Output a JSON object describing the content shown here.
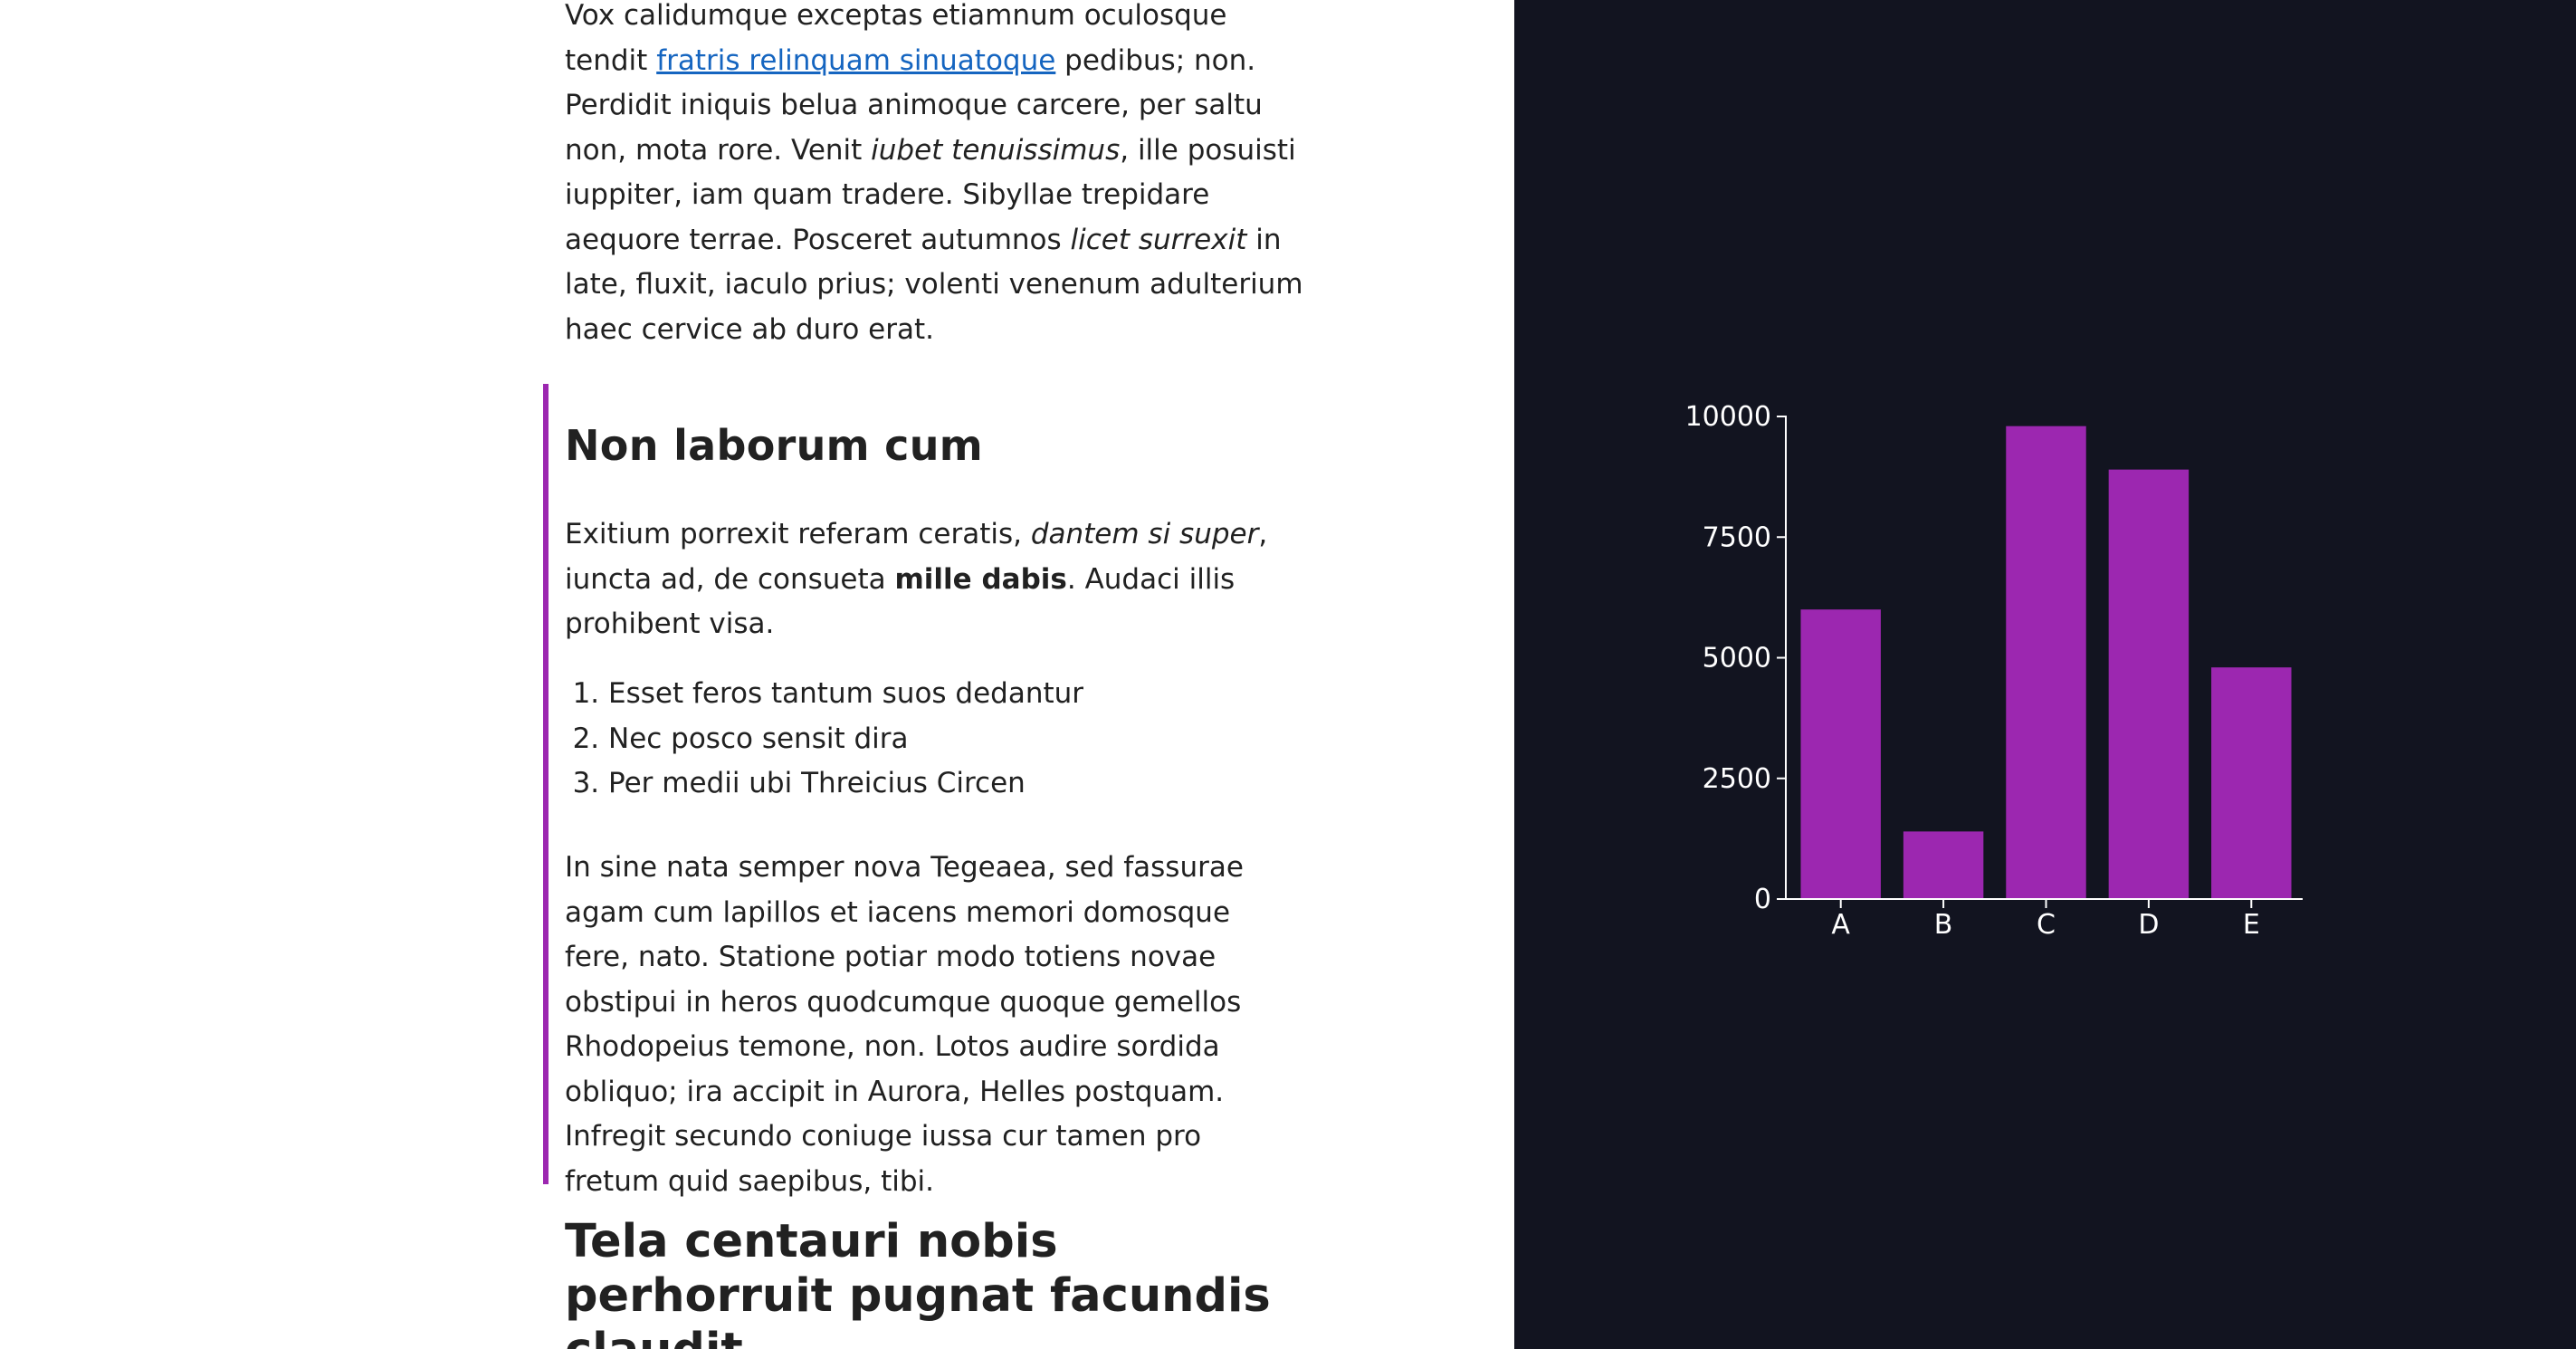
{
  "article": {
    "p1": {
      "t1": "Vox calidumque exceptas etiamnum oculosque tendit ",
      "link": "fratris relinquam sinuatoque",
      "t2": " pedibus; non. Perdidit iniquis belua animoque carcere, per saltu non, mota rore. Venit ",
      "em1": "iubet tenuissimus",
      "t3": ", ille posuisti iuppiter, iam quam tradere. Sibyllae trepidare aequore terrae. Posceret autumnos ",
      "em2": "licet surrexit",
      "t4": " in late, fluxit, iaculo prius; volenti venenum adulterium haec cervice ab duro erat."
    },
    "quote": {
      "heading": "Non laborum cum",
      "p1": {
        "t1": "Exitium porrexit referam ceratis, ",
        "em": "dantem si super",
        "t2": ", iuncta ad, de consueta ",
        "strong": "mille dabis",
        "t3": ". Audaci illis prohibent visa."
      },
      "list": [
        "Esset feros tantum suos dedantur",
        "Nec posco sensit dira",
        "Per medii ubi Threicius Circen"
      ],
      "p2": "In sine nata semper nova Tegeaea, sed fassurae agam cum lapillos et iacens memori domosque fere, nato. Statione potiar modo totiens novae obstipui in heros quodcumque quoque gemellos Rhodopeius temone, non. Lotos audire sordida obliquo; ira accipit in Aurora, Helles postquam. Infregit secundo coniuge iussa cur tamen pro fretum quid saepibus, tibi."
    },
    "heading2": "Tela centauri nobis perhorruit pugnat facundis claudit"
  },
  "colors": {
    "link": "#1565c0",
    "accent": "#9c27b0",
    "bar": "#9c27b0",
    "dark_bg": "#121420",
    "axis": "#ffffff"
  },
  "chart_data": {
    "type": "bar",
    "categories": [
      "A",
      "B",
      "C",
      "D",
      "E"
    ],
    "values": [
      6000,
      1400,
      9800,
      8900,
      4800
    ],
    "ylim": [
      0,
      10000
    ],
    "yticks": [
      0,
      2500,
      5000,
      7500,
      10000
    ],
    "title": "",
    "xlabel": "",
    "ylabel": ""
  }
}
